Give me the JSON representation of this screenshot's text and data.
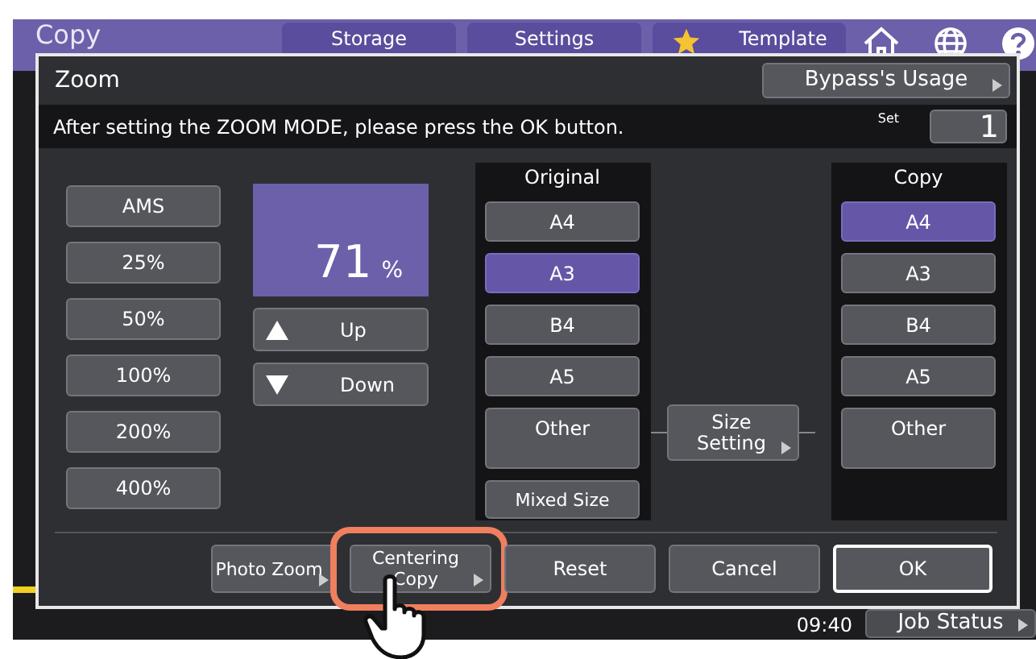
{
  "app": {
    "title": "Copy",
    "tabs": [
      {
        "label": "Storage",
        "kind": "plain"
      },
      {
        "label": "Settings",
        "kind": "plain"
      },
      {
        "label": "Template",
        "kind": "starred"
      }
    ]
  },
  "status_bar": {
    "time": "09:40",
    "button": "Job Status"
  },
  "dialog": {
    "title": "Zoom",
    "usage_button": {
      "label": "Bypass's Usage",
      "has_submenu": true
    },
    "message": "After setting the ZOOM MODE, please press the OK button.",
    "set_label": "Set",
    "set_value": "1",
    "presets": [
      {
        "label": "AMS",
        "selected": false
      },
      {
        "label": "25%",
        "selected": false
      },
      {
        "label": "50%",
        "selected": false
      },
      {
        "label": "100%",
        "selected": false
      },
      {
        "label": "200%",
        "selected": false
      },
      {
        "label": "400%",
        "selected": false
      }
    ],
    "zoom": {
      "value": "71",
      "unit": "%"
    },
    "steppers": [
      {
        "label": "Up",
        "kind": "up"
      },
      {
        "label": "Down",
        "kind": "down"
      }
    ],
    "original": {
      "label": "Original",
      "sizes": [
        {
          "label": "A4",
          "kind": "size",
          "selected": false
        },
        {
          "label": "A3",
          "kind": "size",
          "selected": true
        },
        {
          "label": "B4",
          "kind": "size",
          "selected": false
        },
        {
          "label": "A5",
          "kind": "size",
          "selected": false
        },
        {
          "label": "Other",
          "kind": "custom",
          "selected": false
        }
      ],
      "mixed": "Mixed Size"
    },
    "size_setting": {
      "label": "Size Setting",
      "has_submenu": true
    },
    "copy": {
      "label": "Copy",
      "sizes": [
        {
          "label": "A4",
          "kind": "size",
          "selected": true
        },
        {
          "label": "A3",
          "kind": "size",
          "selected": false
        },
        {
          "label": "B4",
          "kind": "size",
          "selected": false
        },
        {
          "label": "A5",
          "kind": "size",
          "selected": false
        },
        {
          "label": "Other",
          "kind": "custom",
          "selected": false
        }
      ]
    },
    "footer": [
      {
        "label": "Photo Zoom",
        "kind": "normal",
        "has_submenu": true,
        "highlighted": false
      },
      {
        "label": "Centering Copy",
        "kind": "normal",
        "has_submenu": true,
        "highlighted": true
      },
      {
        "label": "Reset",
        "kind": "normal",
        "has_submenu": false,
        "highlighted": false
      },
      {
        "label": "Cancel",
        "kind": "normal",
        "has_submenu": false,
        "highlighted": false
      },
      {
        "label": "OK",
        "kind": "primary",
        "has_submenu": false,
        "highlighted": false
      }
    ]
  }
}
